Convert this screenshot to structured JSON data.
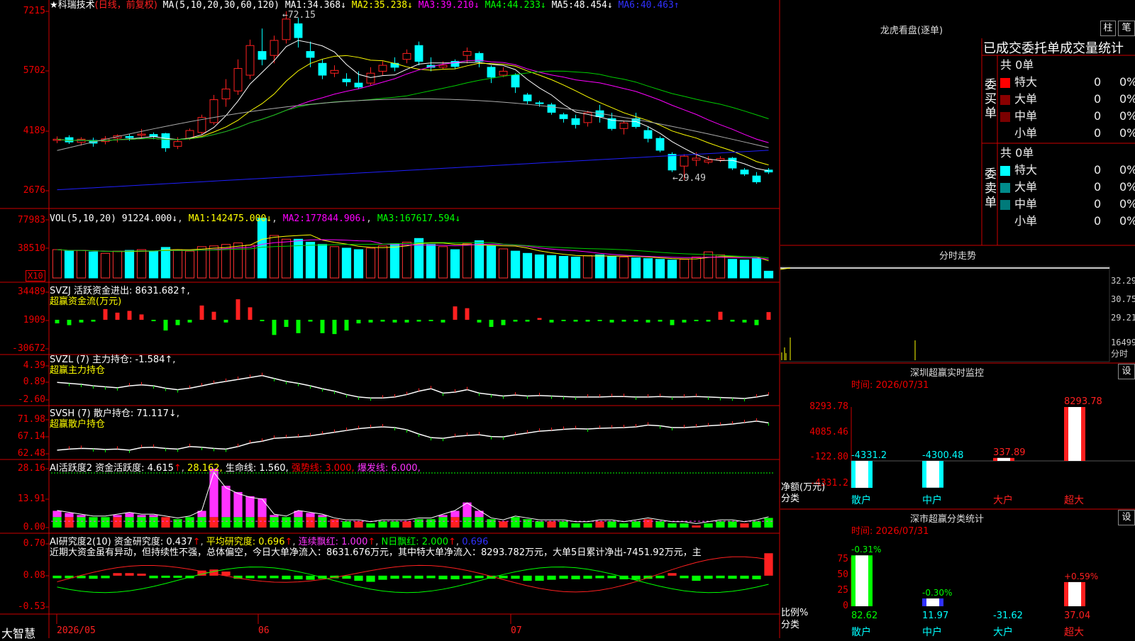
{
  "colors": {
    "up": "#ff2020",
    "down": "#00ffff",
    "vol_up": "#ff3030",
    "vol_down": "#00ffff",
    "bg": "#000000",
    "grid": "#cc0000",
    "ma1": "#ffffff",
    "ma2": "#ffff00",
    "ma3": "#ff00ff",
    "ma4": "#00cc00",
    "ma5": "#aaaaaa",
    "ma6": "#2020ff",
    "green": "#00ff00",
    "magenta": "#ff33ff",
    "yellow": "#ffff00"
  },
  "main": {
    "title": "★科瑞技术",
    "period": "(日线，前复权)",
    "ma_prefix": "MA(5,10,20,30,60,120)",
    "ma_items": [
      {
        "label": "MA1:",
        "value": "34.368↓",
        "color": "#ffffff"
      },
      {
        "label": "MA2:",
        "value": "35.238↓",
        "color": "#ffff00"
      },
      {
        "label": "MA3:",
        "value": "39.210↓",
        "color": "#ff00ff"
      },
      {
        "label": "MA4:",
        "value": "44.233↓",
        "color": "#00ff00"
      },
      {
        "label": "MA5:",
        "value": "48.454↓",
        "color": "#ffffff"
      },
      {
        "label": "MA6:",
        "value": "40.463↑",
        "color": "#3030ff"
      }
    ],
    "y_ticks": [
      "7215",
      "5702",
      "4189",
      "2676"
    ],
    "high_note": "←72.15",
    "low_note": "←29.49"
  },
  "vol": {
    "header": "VOL(5,10,20)",
    "value": "91224.000↓",
    "items": [
      {
        "label": "MA1:",
        "value": "142475.000↓",
        "color": "#ffff00"
      },
      {
        "label": "MA2:",
        "value": "177844.906↓",
        "color": "#ff00ff"
      },
      {
        "label": "MA3:",
        "value": "167617.594↓",
        "color": "#00ff00"
      }
    ],
    "y_ticks": [
      "77983",
      "38510"
    ],
    "unit": "X10"
  },
  "svzj": {
    "header": "SVZJ  活跃资金进出:",
    "value": "8631.682↑,",
    "sub": "超赢资金流(万元)",
    "y_ticks": [
      "34489",
      "1909",
      "-30672"
    ]
  },
  "svzl": {
    "header": "SVZL (7) 主力持仓:",
    "value": "-1.584↑,",
    "sub": "超赢主力持仓",
    "y_ticks": [
      "4.39",
      "0.89",
      "-2.60"
    ]
  },
  "svsh": {
    "header": "SVSH (7) 散户持仓:",
    "value": "71.117↓,",
    "sub": "超赢散户持仓",
    "y_ticks": [
      "71.98",
      "67.14",
      "62.48"
    ]
  },
  "ai1": {
    "header": "AI活跃度2 资金活跃度:",
    "v1": "4.615",
    "v2": "28.162,",
    "life": "生命线: 1.560,",
    "strong": "强势线: 3.000,",
    "burst": "爆发线: 6.000,",
    "y_ticks": [
      "28.16",
      "13.91",
      "0.00"
    ]
  },
  "ai2": {
    "header": "AI研究度2(10) 资金研究度:",
    "v1": "0.437",
    "avg": "平均研究度: 0.696",
    "cont": "连续飘红: 1.000",
    "n": "N日飘红: 2.000",
    "last": "0.696",
    "text": "近期大资金虽有异动，但持续性不强，总体偏空，今日大单净流入：8631.676万元，其中特大单净流入：8293.782万元，大单5日累计净出-7451.92万元，主",
    "y_ticks": [
      "0.70",
      "0.08",
      "-0.53"
    ]
  },
  "xaxis": {
    "brand": "大智慧",
    "labels": [
      "2026/05",
      "06",
      "07"
    ]
  },
  "right": {
    "longhu_title": "龙虎看盘(逐单)",
    "btn_zhu": "柱",
    "btn_bi": "笔",
    "tabs_line": "已成交委托单成交量统计",
    "buy": {
      "vertical": [
        "委",
        "买",
        "单"
      ],
      "total": "共 0单",
      "rows": [
        {
          "name": "特大",
          "count": "0",
          "pct": "0%",
          "color": "#ff0000"
        },
        {
          "name": "大单",
          "count": "0",
          "pct": "0%",
          "color": "#8b0000"
        },
        {
          "name": "中单",
          "count": "0",
          "pct": "0%",
          "color": "#7a0000"
        },
        {
          "name": "小单",
          "count": "0",
          "pct": "0%",
          "color": "#000000"
        }
      ]
    },
    "sell": {
      "vertical": [
        "委",
        "卖",
        "单"
      ],
      "total": "共 0单",
      "rows": [
        {
          "name": "特大",
          "count": "0",
          "pct": "0%",
          "color": "#00ffff"
        },
        {
          "name": "大单",
          "count": "0",
          "pct": "0%",
          "color": "#008b8b"
        },
        {
          "name": "中单",
          "count": "0",
          "pct": "0%",
          "color": "#007a7a"
        },
        {
          "name": "小单",
          "count": "0",
          "pct": "0%",
          "color": "#000000"
        }
      ]
    },
    "fenshi": {
      "title": "分时走势",
      "y_ticks": [
        "32.29",
        "30.75",
        "29.21",
        "16499"
      ],
      "vol_unit": "分时"
    },
    "sz_monitor": {
      "title": "深圳超赢实时监控",
      "btn": "设",
      "time": "时间: 2026/07/31",
      "y_ticks": [
        "8293.78",
        "4085.46",
        "-122.80",
        "-4331.2"
      ],
      "y_title": "净额(万元)",
      "x_title": "分类",
      "categories": [
        "散户",
        "中户",
        "大户",
        "超大"
      ],
      "values": [
        -4331.2,
        -4300.48,
        337.89,
        8293.78
      ],
      "value_labels": [
        "-4331.2",
        "-4300.48",
        "337.89",
        "8293.78"
      ]
    },
    "sz_class": {
      "title": "深市超赢分类统计",
      "btn": "设",
      "time": "时间: 2026/07/31",
      "y_ticks": [
        "75",
        "50",
        "25",
        "0"
      ],
      "y_title": "比例%",
      "x_title": "分类",
      "categories": [
        "散户",
        "中户",
        "大户",
        "超大"
      ],
      "values": [
        82.62,
        11.97,
        -31.62,
        37.04
      ],
      "top_labels": [
        "-0.31%",
        "-0.30%",
        "",
        "+0.59%"
      ],
      "bottom_labels": [
        "82.62",
        "11.97",
        "-31.62",
        "37.04"
      ]
    }
  },
  "chart_data": [
    {
      "type": "candlestick",
      "title": "科瑞技术 日线 前复权",
      "ylim": [
        26.76,
        72.15
      ],
      "y_ticks": [
        72.15,
        57.02,
        41.89,
        26.76
      ],
      "x_labels": [
        "2026/05",
        "06",
        "07"
      ],
      "candles": [
        [
          39.5,
          40.5,
          38.8,
          39.8
        ],
        [
          40.2,
          40.8,
          38.6,
          39.1
        ],
        [
          39.0,
          40.3,
          38.2,
          39.8
        ],
        [
          39.5,
          40.2,
          37.9,
          38.8
        ],
        [
          39.2,
          40.6,
          38.5,
          39.9
        ],
        [
          40.1,
          41.0,
          39.0,
          40.7
        ],
        [
          40.5,
          41.2,
          39.4,
          40.2
        ],
        [
          40.8,
          42.4,
          39.9,
          41.1
        ],
        [
          41.0,
          41.5,
          39.8,
          40.5
        ],
        [
          41.2,
          41.4,
          36.6,
          37.6
        ],
        [
          38.0,
          40.3,
          37.3,
          39.2
        ],
        [
          40.0,
          42.5,
          39.6,
          42.0
        ],
        [
          41.5,
          46.0,
          41.0,
          45.3
        ],
        [
          44.0,
          51.0,
          43.5,
          49.8
        ],
        [
          50.0,
          55.0,
          48.0,
          52.5
        ],
        [
          52.0,
          60.0,
          51.0,
          57.7
        ],
        [
          56.0,
          65.0,
          55.0,
          63.5
        ],
        [
          62.0,
          67.8,
          58.5,
          60.0
        ],
        [
          61.0,
          66.0,
          59.0,
          64.8
        ],
        [
          65.0,
          72.15,
          64.0,
          70.2
        ],
        [
          69.0,
          70.5,
          63.0,
          65.5
        ],
        [
          62.0,
          64.5,
          58.0,
          60.5
        ],
        [
          59.0,
          60.0,
          55.0,
          56.0
        ],
        [
          56.5,
          58.5,
          55.5,
          57.2
        ],
        [
          55.0,
          56.5,
          53.2,
          54.3
        ],
        [
          54.0,
          57.0,
          52.5,
          53.0
        ],
        [
          54.0,
          58.0,
          53.5,
          56.5
        ],
        [
          57.0,
          59.5,
          56.0,
          58.5
        ],
        [
          59.0,
          60.5,
          57.0,
          58.0
        ],
        [
          60.0,
          62.5,
          59.0,
          61.5
        ],
        [
          63.5,
          64.5,
          58.5,
          59.5
        ],
        [
          58.5,
          60.5,
          57.0,
          58.0
        ],
        [
          58.0,
          59.5,
          57.5,
          58.5
        ],
        [
          59.5,
          60.0,
          57.5,
          58.2
        ],
        [
          61.0,
          63.0,
          59.0,
          62.0
        ],
        [
          61.5,
          62.0,
          58.0,
          59.5
        ],
        [
          58.0,
          58.5,
          54.0,
          55.5
        ],
        [
          56.0,
          58.0,
          55.5,
          57.0
        ],
        [
          56.0,
          56.5,
          51.5,
          53.0
        ],
        [
          51.0,
          51.5,
          48.6,
          49.5
        ],
        [
          49.0,
          49.5,
          48.0,
          48.8
        ],
        [
          48.5,
          49.0,
          46.0,
          46.6
        ],
        [
          46.0,
          46.5,
          44.0,
          45.0
        ],
        [
          45.0,
          46.0,
          42.5,
          43.5
        ],
        [
          44.0,
          47.0,
          43.0,
          46.5
        ],
        [
          47.0,
          48.5,
          44.0,
          45.5
        ],
        [
          45.0,
          46.5,
          42.0,
          42.5
        ],
        [
          42.5,
          44.5,
          41.0,
          43.9
        ],
        [
          45.0,
          46.5,
          42.5,
          43.0
        ],
        [
          42.0,
          43.0,
          39.0,
          40.0
        ],
        [
          40.0,
          40.5,
          36.5,
          37.0
        ],
        [
          36.0,
          36.5,
          31.5,
          32.0
        ],
        [
          33.0,
          36.0,
          29.49,
          35.5
        ],
        [
          34.5,
          36.5,
          33.0,
          35.0
        ],
        [
          34.0,
          35.5,
          33.5,
          34.5
        ],
        [
          34.5,
          35.5,
          34.0,
          34.9
        ],
        [
          35.0,
          35.3,
          32.0,
          32.5
        ],
        [
          32.0,
          32.5,
          30.5,
          31.0
        ],
        [
          30.5,
          31.5,
          28.5,
          29.0
        ],
        [
          32.0,
          32.5,
          31.0,
          31.5
        ]
      ]
    },
    {
      "type": "bar",
      "title": "VOL(5,10,20)",
      "ylim": [
        0,
        77983
      ],
      "y_ticks": [
        77983,
        38510
      ],
      "values": [
        38000,
        36000,
        37000,
        35000,
        33000,
        36000,
        37000,
        38000,
        36000,
        41000,
        38000,
        36000,
        42000,
        43000,
        45000,
        47000,
        44000,
        80000,
        57000,
        52000,
        52000,
        48000,
        45000,
        42000,
        40000,
        38000,
        40000,
        43000,
        46000,
        48000,
        53000,
        45000,
        42000,
        38000,
        46000,
        50000,
        43000,
        39000,
        36000,
        33000,
        31000,
        30000,
        29000,
        28000,
        30000,
        31000,
        29000,
        28000,
        27000,
        26000,
        25000,
        24000,
        25000,
        28000,
        35000,
        31000,
        25000,
        24000,
        26000,
        9122
      ]
    },
    {
      "type": "bar",
      "title": "SVZJ 活跃资金进出",
      "ylim": [
        -30672,
        34489
      ],
      "y_ticks": [
        34489,
        1909,
        -30672
      ],
      "values": [
        -4000,
        -6000,
        -3000,
        -2000,
        12000,
        8000,
        10000,
        6000,
        -1000,
        -12000,
        -6000,
        -3000,
        16000,
        9000,
        -3000,
        23000,
        14000,
        -1000,
        -17000,
        -8000,
        -15000,
        -2000,
        -15000,
        -16000,
        -12000,
        -4000,
        -3000,
        -2000,
        -3000,
        -3000,
        -2000,
        -1000,
        -3000,
        15000,
        13000,
        -3000,
        -8000,
        -6000,
        -2000,
        -2000,
        2000,
        -3000,
        -1000,
        -2000,
        -2000,
        -1000,
        -3000,
        -2000,
        -2000,
        -3000,
        -2000,
        -6000,
        -3000,
        -1000,
        -2000,
        9000,
        -2000,
        -3000,
        -6000,
        8632
      ]
    },
    {
      "type": "line",
      "title": "SVZL 主力持仓",
      "ylim": [
        -2.6,
        4.39
      ],
      "y_ticks": [
        4.39,
        0.89,
        -2.6
      ],
      "values": [
        1.0,
        0.8,
        0.6,
        0.3,
        0.1,
        -0.1,
        0.3,
        0.5,
        0.3,
        -0.2,
        -0.5,
        -0.2,
        0.3,
        0.8,
        1.2,
        1.6,
        2.0,
        2.4,
        1.8,
        1.2,
        0.8,
        0.3,
        -0.3,
        -0.8,
        -1.5,
        -2.0,
        -2.2,
        -2.2,
        -2.0,
        -1.5,
        -0.8,
        -0.3,
        -1.2,
        -1.0,
        -0.5,
        -1.2,
        -1.5,
        -1.8,
        -1.6,
        -1.8,
        -1.7,
        -1.8,
        -1.9,
        -2.0,
        -2.0,
        -2.0,
        -1.9,
        -1.9,
        -2.0,
        -2.0,
        -1.9,
        -2.0,
        -2.0,
        -1.9,
        -2.0,
        -2.1,
        -2.2,
        -2.3,
        -2.0,
        -1.584
      ]
    },
    {
      "type": "line",
      "title": "SVSH 散户持仓",
      "ylim": [
        62.48,
        71.98
      ],
      "y_ticks": [
        71.98,
        67.14,
        62.48
      ],
      "values": [
        63.5,
        63.8,
        64.0,
        63.9,
        63.7,
        63.8,
        63.5,
        64.2,
        64.3,
        64.0,
        63.8,
        64.5,
        64.3,
        64.0,
        63.8,
        64.5,
        65.5,
        66.0,
        66.8,
        67.0,
        67.2,
        67.5,
        68.0,
        68.5,
        69.0,
        69.5,
        69.8,
        70.0,
        69.8,
        69.2,
        68.0,
        67.0,
        66.8,
        67.3,
        67.6,
        67.8,
        67.3,
        67.2,
        67.8,
        68.3,
        68.8,
        69.0,
        69.3,
        69.5,
        69.4,
        69.6,
        69.7,
        69.8,
        70.0,
        70.5,
        70.3,
        69.8,
        69.8,
        70.0,
        70.3,
        70.5,
        70.8,
        71.2,
        71.6,
        71.117
      ]
    },
    {
      "type": "bar",
      "title": "AI活跃度2 资金活跃度",
      "ylim": [
        0,
        28.16
      ],
      "y_ticks": [
        28.16,
        13.91,
        0.0
      ],
      "values": [
        8,
        7,
        6,
        5,
        5,
        6,
        7,
        6,
        6,
        5,
        4,
        5,
        8,
        28.16,
        20,
        17,
        15,
        14,
        6,
        5,
        8,
        7,
        6,
        4,
        3,
        3,
        2,
        3,
        3,
        3,
        4,
        4,
        6,
        8,
        12,
        8,
        4,
        3,
        5,
        4,
        3,
        3,
        3,
        2,
        2,
        3,
        3,
        2,
        3,
        4,
        3,
        2,
        2,
        1,
        2,
        3,
        3,
        2,
        3,
        4.615
      ],
      "reference_lines": [
        {
          "name": "生命线",
          "value": 1.56
        },
        {
          "name": "强势线",
          "value": 3.0
        },
        {
          "name": "爆发线",
          "value": 6.0
        }
      ]
    },
    {
      "type": "bar",
      "title": "AI研究度2(10) 资金研究度",
      "ylim": [
        -0.53,
        0.7
      ],
      "y_ticks": [
        0.7,
        0.08,
        -0.53
      ],
      "values": [
        -0.05,
        -0.05,
        -0.05,
        -0.06,
        -0.05,
        0.05,
        0.05,
        0.04,
        -0.05,
        -0.04,
        -0.04,
        -0.05,
        0.1,
        0.12,
        0.08,
        -0.06,
        -0.05,
        -0.05,
        -0.05,
        -0.07,
        -0.07,
        -0.08,
        -0.06,
        -0.05,
        -0.06,
        -0.1,
        -0.12,
        -0.08,
        -0.06,
        -0.05,
        -0.06,
        -0.05,
        -0.07,
        -0.07,
        -0.06,
        -0.05,
        -0.06,
        -0.05,
        -0.06,
        -0.1,
        -0.1,
        -0.08,
        -0.06,
        -0.07,
        -0.06,
        -0.05,
        -0.05,
        -0.07,
        -0.08,
        -0.06,
        -0.05,
        0.05,
        -0.05,
        -0.1,
        -0.06,
        -0.05,
        -0.06,
        -0.06,
        -0.07,
        0.437
      ]
    },
    {
      "type": "bar",
      "title": "深圳超赢实时监控",
      "categories": [
        "散户",
        "中户",
        "大户",
        "超大"
      ],
      "values": [
        -4331.2,
        -4300.48,
        337.89,
        8293.78
      ],
      "ylim": [
        -4331.2,
        8293.78
      ]
    },
    {
      "type": "bar",
      "title": "深市超赢分类统计",
      "categories": [
        "散户",
        "中户",
        "大户",
        "超大"
      ],
      "values": [
        82.62,
        11.97,
        -31.62,
        37.04
      ],
      "ylim": [
        0,
        75
      ]
    }
  ]
}
